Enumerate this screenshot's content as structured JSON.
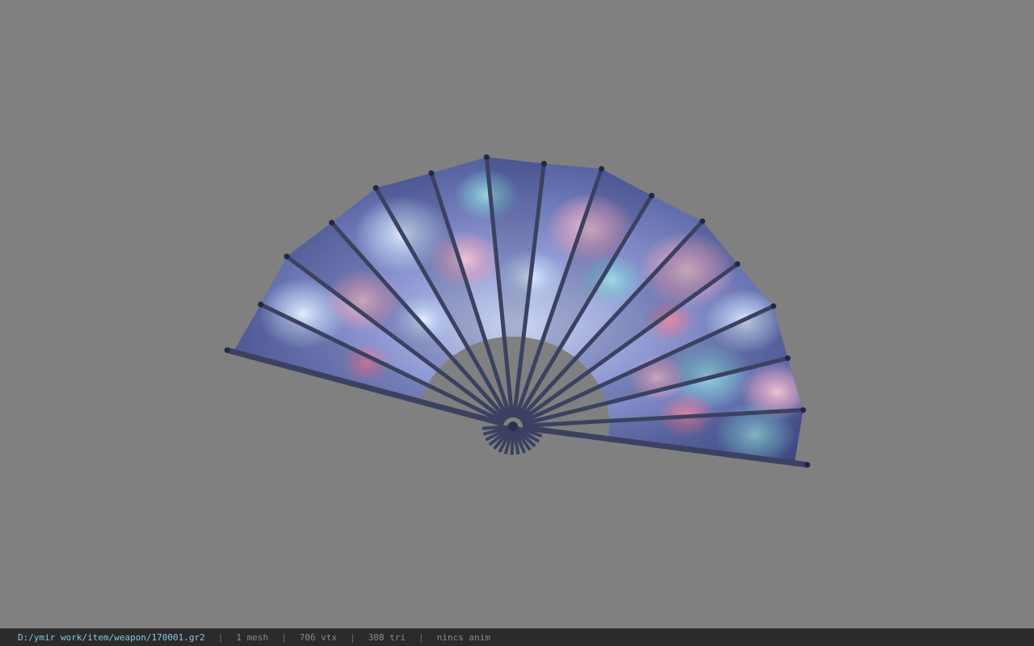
{
  "status": {
    "file_path": "D:/ymir work/item/weapon/170001.gr2",
    "separator": "|",
    "mesh_count": "1 mesh",
    "vertex_count": "706 vtx",
    "triangle_count": "308 tri",
    "anim_status": "nincs anim"
  },
  "colors": {
    "background": "#808080",
    "statusbar": "#2b2b2b",
    "path_text": "#7fc8e8",
    "stat_text": "#8a8a8a",
    "fan_rib": "#3b4160"
  },
  "model": {
    "object": "folding-fan",
    "rib_count": 16
  }
}
